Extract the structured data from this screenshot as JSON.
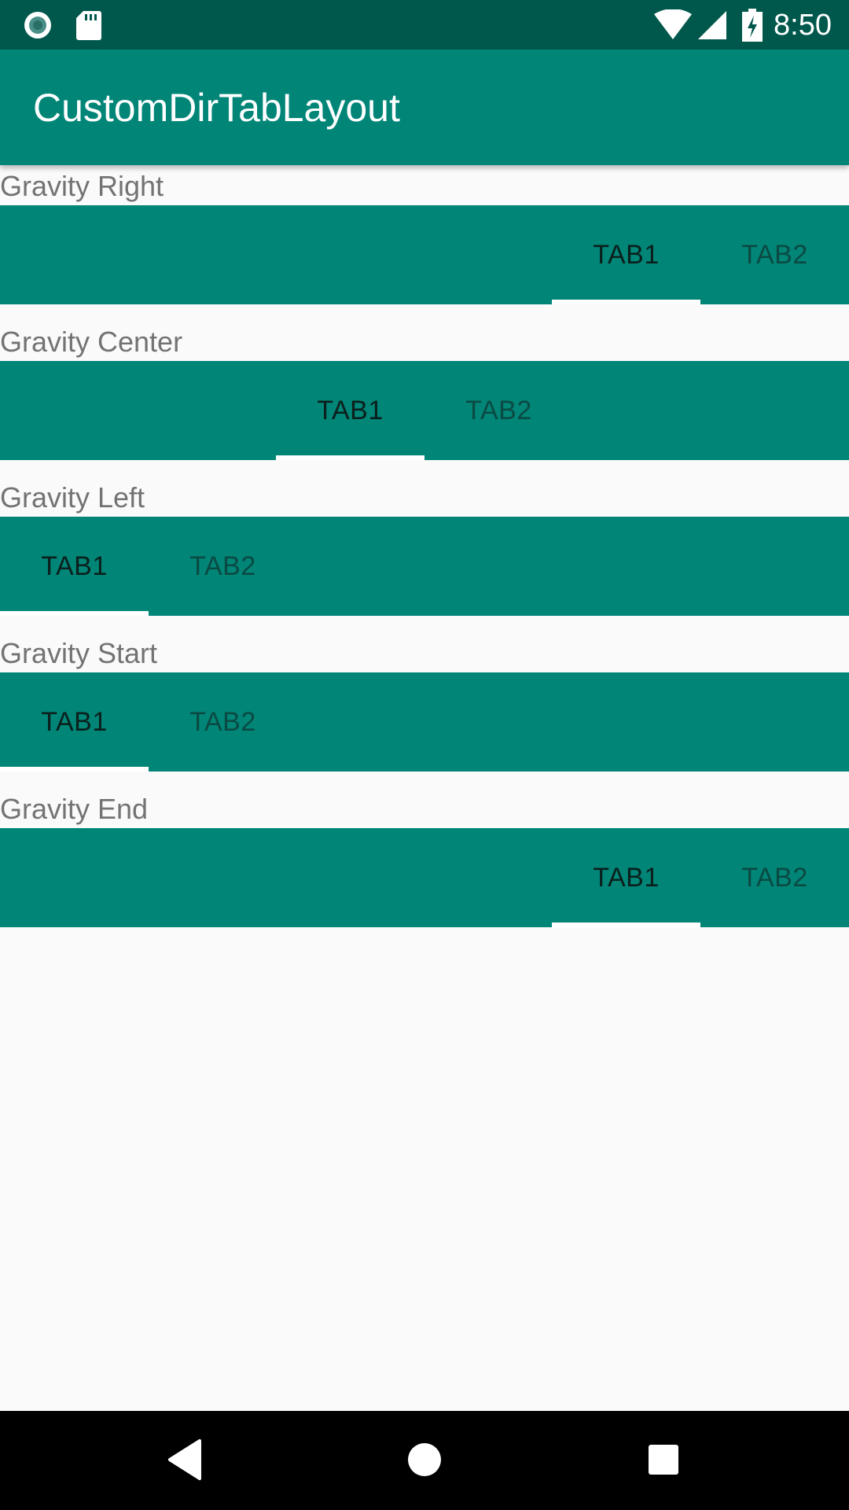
{
  "status_bar": {
    "time": "8:50",
    "icons": [
      "radio-button-icon",
      "sd-card-icon",
      "wifi-icon",
      "cell-signal-icon",
      "battery-charging-icon"
    ]
  },
  "app_bar": {
    "title": "CustomDirTabLayout"
  },
  "sections": [
    {
      "label": "Gravity Right",
      "tabs": [
        "TAB1",
        "TAB2"
      ],
      "selected": "TAB1"
    },
    {
      "label": "Gravity Center",
      "tabs": [
        "TAB1",
        "TAB2"
      ],
      "selected": "TAB1"
    },
    {
      "label": "Gravity Left",
      "tabs": [
        "TAB1",
        "TAB2"
      ],
      "selected": "TAB1"
    },
    {
      "label": "Gravity Start",
      "tabs": [
        "TAB1",
        "TAB2"
      ],
      "selected": "TAB1"
    },
    {
      "label": "Gravity End",
      "tabs": [
        "TAB1",
        "TAB2"
      ],
      "selected": "TAB1"
    }
  ],
  "nav_bar": {
    "buttons": [
      "back-icon",
      "home-icon",
      "recents-icon"
    ]
  },
  "colors": {
    "status_bar": "#00574b",
    "primary": "#008577",
    "indicator": "#ffffff",
    "background": "#fafafa",
    "label_text": "#737373"
  }
}
